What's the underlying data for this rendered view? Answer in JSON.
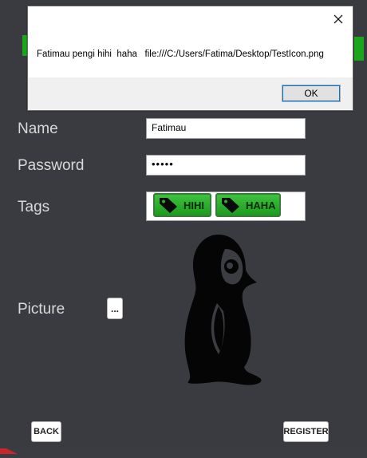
{
  "form": {
    "name_label": "Name",
    "name_value": "Fatimau",
    "password_label": "Password",
    "password_value": "•••••",
    "tags_label": "Tags",
    "tags": [
      {
        "label": "HIHI"
      },
      {
        "label": "HAHA"
      }
    ],
    "picture_label": "Picture",
    "browse_label": "...",
    "picture_icon": "penguin-icon",
    "back_label": "BACK",
    "register_label": "REGISTER"
  },
  "dialog": {
    "message": "Fatimau pengi hihi  haha   file:///C:/Users/Fatima/Desktop/TestIcon.png",
    "ok_label": "OK",
    "close_icon": "close-icon"
  },
  "colors": {
    "background": "#393b40",
    "tag_green": "#22a622",
    "label_text": "#d9d9d9"
  }
}
